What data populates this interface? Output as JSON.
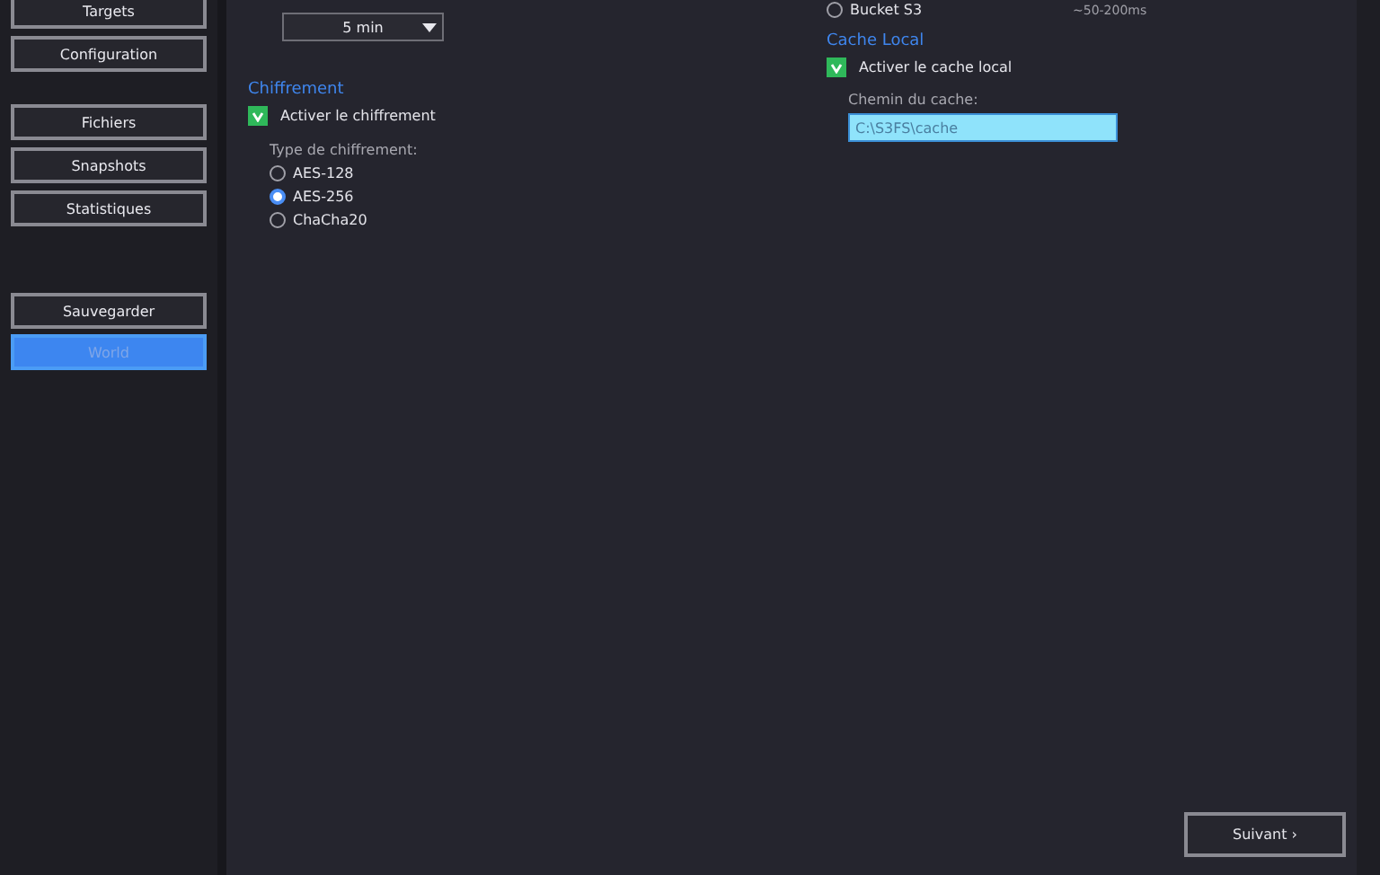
{
  "sidebar": {
    "groups": [
      {
        "items": [
          {
            "label": "Targets",
            "selected": false
          },
          {
            "label": "Configuration",
            "selected": false
          }
        ]
      },
      {
        "items": [
          {
            "label": "Fichiers",
            "selected": false
          },
          {
            "label": "Snapshots",
            "selected": false
          },
          {
            "label": "Statistiques",
            "selected": false
          }
        ]
      },
      {
        "items": [
          {
            "label": "Sauvegarder",
            "selected": false
          },
          {
            "label": "World",
            "selected": true
          }
        ]
      }
    ]
  },
  "left_column": {
    "interval": {
      "value": "5 min"
    },
    "encryption": {
      "title": "Chiffrement",
      "enable": {
        "label": "Activer le chiffrement",
        "checked": true
      },
      "type_label": "Type de chiffrement:",
      "options": [
        {
          "label": "AES-128",
          "selected": false
        },
        {
          "label": "AES-256",
          "selected": true
        },
        {
          "label": "ChaCha20",
          "selected": false
        }
      ]
    }
  },
  "right_column": {
    "storage_option": {
      "label": "Bucket S3",
      "selected": false,
      "latency": "~50-200ms"
    },
    "cache": {
      "title": "Cache Local",
      "enable": {
        "label": "Activer le cache local",
        "checked": true
      },
      "path_label": "Chemin du cache:",
      "path_value": "C:\\S3FS\\cache"
    }
  },
  "footer": {
    "next_button": "Suivant ›"
  }
}
